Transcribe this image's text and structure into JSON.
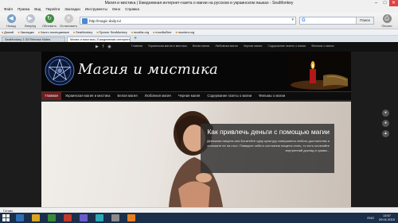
{
  "window": {
    "title": "Магия и мистика | Ежедневная интернет-газета о магии на русском и украинском языках - SeaMonkey",
    "min": "–",
    "max": "□",
    "close": "✕"
  },
  "menubar": [
    "Файл",
    "Правка",
    "Вид",
    "Перейти",
    "Закладки",
    "Инструменты",
    "Окно",
    "Справка"
  ],
  "toolbar": {
    "back": "Назад",
    "forward": "Вперёд",
    "reload": "Обновить",
    "stop": "Остановить",
    "url": "http://magic-daily.ru/",
    "search_button": "Поиск",
    "print": "Печать"
  },
  "bookmarks": [
    "Домой",
    "Закладки",
    "Часто посещаемые",
    "SeaMonkey",
    "Проект SeaMonkey",
    "mozilla.org",
    "mozillaZine",
    "mozdev.org"
  ],
  "tabs": [
    "SeaMonkey 2.33 Release Notes",
    "Магия и мистика | Ежедневная интернет..."
  ],
  "site": {
    "top_links": [
      "Главная",
      "Украинская магия и мистика",
      "Белая магия",
      "Любовная магия",
      "Черная магия",
      "Содержание газеты о магии",
      "Фильмы о магии"
    ],
    "logo": "Магия   и мистика",
    "nav": [
      "Главная",
      "Украинская магия и мистика",
      "Белая магия",
      "Любовная магия",
      "Черная магия",
      "Содержание газеты о магии",
      "Фильмы о магии"
    ],
    "hero_title": "Как привлечь деньги с помощью магии",
    "hero_text": "Денежная нищета или Богатейте одну культуру совершенно любого достоинства и положите ее на стол. Поведите себя в состоянии нищеты стать, то есть осознайте внутренний доклад и сумма..."
  },
  "status": "Готово",
  "taskbar": {
    "time": "13:57",
    "date": "29.01.2015",
    "lang": "ENG"
  }
}
